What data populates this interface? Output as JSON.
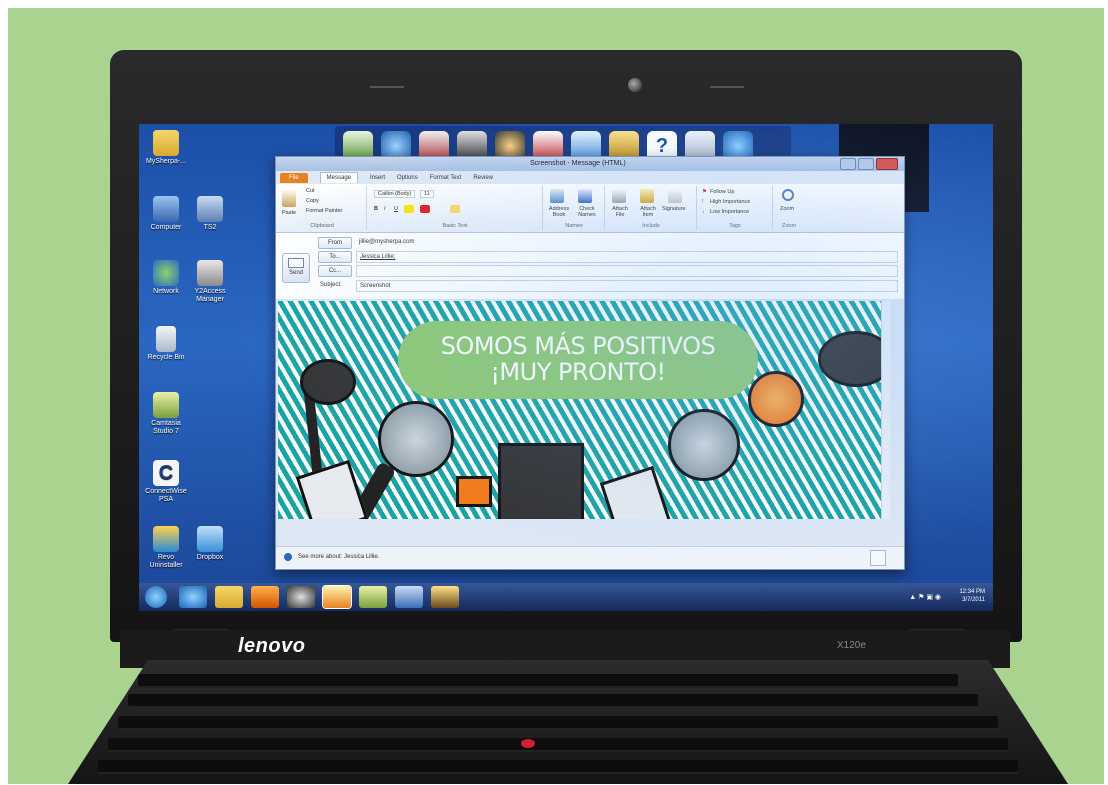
{
  "desktop": {
    "icons": [
      {
        "label": "MySherpa-...",
        "icon": "folder-icon"
      },
      {
        "label": "Computer",
        "icon": "computer-icon"
      },
      {
        "label": "TS2",
        "icon": "ts2-icon"
      },
      {
        "label": "Network",
        "icon": "network-icon"
      },
      {
        "label": "Y2Access Manager",
        "icon": "y2access-icon"
      },
      {
        "label": "Recycle Bin",
        "icon": "recycle-bin-icon"
      },
      {
        "label": "Camtasia Studio 7",
        "icon": "camtasia-icon"
      },
      {
        "label": "ConnectWise PSA",
        "icon": "connectwise-icon"
      },
      {
        "label": "Revo Uninstaller",
        "icon": "revo-icon"
      },
      {
        "label": "Dropbox",
        "icon": "dropbox-icon"
      }
    ]
  },
  "window": {
    "title": "Screenshot - Message (HTML)",
    "tabs": [
      "File",
      "Message",
      "Insert",
      "Options",
      "Format Text",
      "Review"
    ],
    "ribbon": {
      "clipboard": {
        "paste": "Paste",
        "cut": "Cut",
        "copy": "Copy",
        "format_painter": "Format Painter",
        "label": "Clipboard"
      },
      "basic_text": {
        "font": "Calibri (Body)",
        "size": "11",
        "label": "Basic Text"
      },
      "names": {
        "address_book": "Address Book",
        "check_names": "Check Names",
        "label": "Names"
      },
      "include": {
        "attach_file": "Attach File",
        "attach_item": "Attach Item",
        "signature": "Signature",
        "label": "Include"
      },
      "tags": {
        "follow_up": "Follow Up",
        "high": "High Importance",
        "low": "Low Importance",
        "label": "Tags"
      },
      "zoom": {
        "zoom": "Zoom",
        "label": "Zoom"
      }
    },
    "header": {
      "send": "Send",
      "from_btn": "From",
      "from_value": "jillie@mysherpa.com",
      "to_btn": "To...",
      "to_value": "Jessica Lillie;",
      "cc_btn": "Cc...",
      "cc_value": "",
      "subject_label": "Subject:",
      "subject_value": "Screenshot"
    },
    "banner": {
      "line1": "SOMOS MÁS POSITIVOS",
      "line2": "¡MUY PRONTO!"
    },
    "people_pane": "See more about: Jessica Lillie."
  },
  "taskbar": {
    "time": "12:34 PM",
    "date": "3/7/2011"
  },
  "laptop": {
    "brand": "lenovo",
    "model": "X120e"
  },
  "colors": {
    "background": "#a9d38f",
    "banner_teal": "#1aa3a3",
    "banner_bubble": "#8fc971",
    "file_tab": "#e8821e"
  }
}
